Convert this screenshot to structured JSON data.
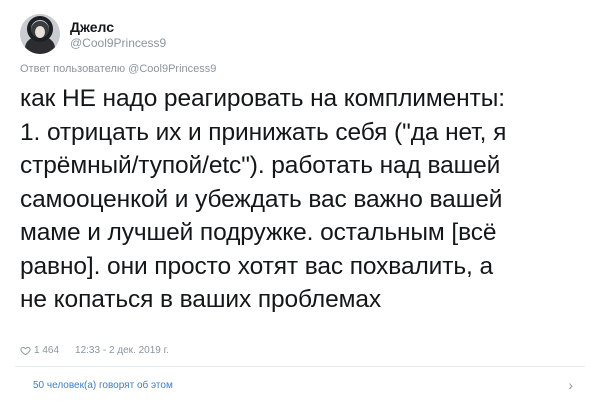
{
  "author": {
    "display_name": "Джелс",
    "handle": "@Cool9Princess9"
  },
  "reply_to": "Ответ пользователю @Cool9Princess9",
  "tweet": {
    "text": "как НЕ надо реагировать на комплименты:\n1. отрицать их и принижать себя (\"да нет, я\nстрёмный/тупой/etc\"). работать над вашей\nсамооценкой и убеждать вас важно вашей\nмаме и лучшей подружке. остальным [всё\nравно]. они просто хотят вас похвалить, а\nне копаться в ваших проблемах"
  },
  "meta": {
    "likes": "1 464",
    "timestamp": "12:33 - 2 дек. 2019 г."
  },
  "conversation": {
    "label": "50 человек(а) говорят об этом"
  },
  "icons": {
    "like": "heart-icon",
    "more": "chevron-right-icon"
  },
  "colors": {
    "link": "#3f7fbf",
    "muted": "#8a959e",
    "text": "#14171a"
  }
}
